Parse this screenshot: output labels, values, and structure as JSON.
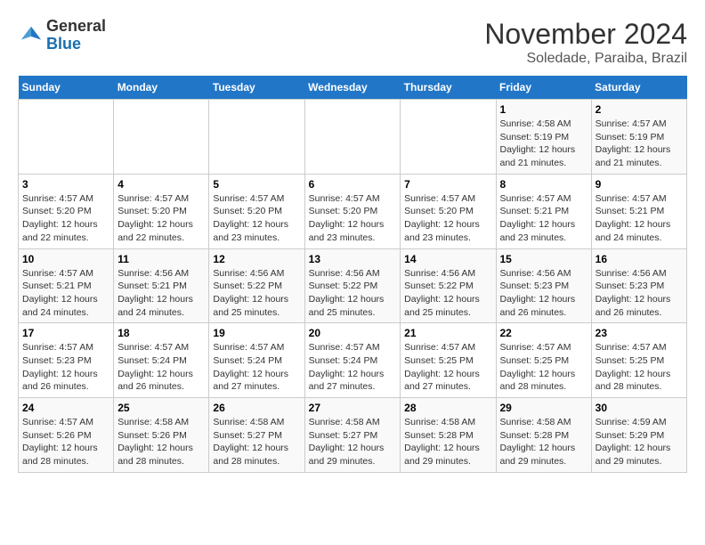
{
  "logo": {
    "line1": "General",
    "line2": "Blue"
  },
  "title": "November 2024",
  "subtitle": "Soledade, Paraiba, Brazil",
  "weekdays": [
    "Sunday",
    "Monday",
    "Tuesday",
    "Wednesday",
    "Thursday",
    "Friday",
    "Saturday"
  ],
  "weeks": [
    [
      {
        "day": "",
        "info": ""
      },
      {
        "day": "",
        "info": ""
      },
      {
        "day": "",
        "info": ""
      },
      {
        "day": "",
        "info": ""
      },
      {
        "day": "",
        "info": ""
      },
      {
        "day": "1",
        "info": "Sunrise: 4:58 AM\nSunset: 5:19 PM\nDaylight: 12 hours and 21 minutes."
      },
      {
        "day": "2",
        "info": "Sunrise: 4:57 AM\nSunset: 5:19 PM\nDaylight: 12 hours and 21 minutes."
      }
    ],
    [
      {
        "day": "3",
        "info": "Sunrise: 4:57 AM\nSunset: 5:20 PM\nDaylight: 12 hours and 22 minutes."
      },
      {
        "day": "4",
        "info": "Sunrise: 4:57 AM\nSunset: 5:20 PM\nDaylight: 12 hours and 22 minutes."
      },
      {
        "day": "5",
        "info": "Sunrise: 4:57 AM\nSunset: 5:20 PM\nDaylight: 12 hours and 23 minutes."
      },
      {
        "day": "6",
        "info": "Sunrise: 4:57 AM\nSunset: 5:20 PM\nDaylight: 12 hours and 23 minutes."
      },
      {
        "day": "7",
        "info": "Sunrise: 4:57 AM\nSunset: 5:20 PM\nDaylight: 12 hours and 23 minutes."
      },
      {
        "day": "8",
        "info": "Sunrise: 4:57 AM\nSunset: 5:21 PM\nDaylight: 12 hours and 23 minutes."
      },
      {
        "day": "9",
        "info": "Sunrise: 4:57 AM\nSunset: 5:21 PM\nDaylight: 12 hours and 24 minutes."
      }
    ],
    [
      {
        "day": "10",
        "info": "Sunrise: 4:57 AM\nSunset: 5:21 PM\nDaylight: 12 hours and 24 minutes."
      },
      {
        "day": "11",
        "info": "Sunrise: 4:56 AM\nSunset: 5:21 PM\nDaylight: 12 hours and 24 minutes."
      },
      {
        "day": "12",
        "info": "Sunrise: 4:56 AM\nSunset: 5:22 PM\nDaylight: 12 hours and 25 minutes."
      },
      {
        "day": "13",
        "info": "Sunrise: 4:56 AM\nSunset: 5:22 PM\nDaylight: 12 hours and 25 minutes."
      },
      {
        "day": "14",
        "info": "Sunrise: 4:56 AM\nSunset: 5:22 PM\nDaylight: 12 hours and 25 minutes."
      },
      {
        "day": "15",
        "info": "Sunrise: 4:56 AM\nSunset: 5:23 PM\nDaylight: 12 hours and 26 minutes."
      },
      {
        "day": "16",
        "info": "Sunrise: 4:56 AM\nSunset: 5:23 PM\nDaylight: 12 hours and 26 minutes."
      }
    ],
    [
      {
        "day": "17",
        "info": "Sunrise: 4:57 AM\nSunset: 5:23 PM\nDaylight: 12 hours and 26 minutes."
      },
      {
        "day": "18",
        "info": "Sunrise: 4:57 AM\nSunset: 5:24 PM\nDaylight: 12 hours and 26 minutes."
      },
      {
        "day": "19",
        "info": "Sunrise: 4:57 AM\nSunset: 5:24 PM\nDaylight: 12 hours and 27 minutes."
      },
      {
        "day": "20",
        "info": "Sunrise: 4:57 AM\nSunset: 5:24 PM\nDaylight: 12 hours and 27 minutes."
      },
      {
        "day": "21",
        "info": "Sunrise: 4:57 AM\nSunset: 5:25 PM\nDaylight: 12 hours and 27 minutes."
      },
      {
        "day": "22",
        "info": "Sunrise: 4:57 AM\nSunset: 5:25 PM\nDaylight: 12 hours and 28 minutes."
      },
      {
        "day": "23",
        "info": "Sunrise: 4:57 AM\nSunset: 5:25 PM\nDaylight: 12 hours and 28 minutes."
      }
    ],
    [
      {
        "day": "24",
        "info": "Sunrise: 4:57 AM\nSunset: 5:26 PM\nDaylight: 12 hours and 28 minutes."
      },
      {
        "day": "25",
        "info": "Sunrise: 4:58 AM\nSunset: 5:26 PM\nDaylight: 12 hours and 28 minutes."
      },
      {
        "day": "26",
        "info": "Sunrise: 4:58 AM\nSunset: 5:27 PM\nDaylight: 12 hours and 28 minutes."
      },
      {
        "day": "27",
        "info": "Sunrise: 4:58 AM\nSunset: 5:27 PM\nDaylight: 12 hours and 29 minutes."
      },
      {
        "day": "28",
        "info": "Sunrise: 4:58 AM\nSunset: 5:28 PM\nDaylight: 12 hours and 29 minutes."
      },
      {
        "day": "29",
        "info": "Sunrise: 4:58 AM\nSunset: 5:28 PM\nDaylight: 12 hours and 29 minutes."
      },
      {
        "day": "30",
        "info": "Sunrise: 4:59 AM\nSunset: 5:29 PM\nDaylight: 12 hours and 29 minutes."
      }
    ]
  ]
}
